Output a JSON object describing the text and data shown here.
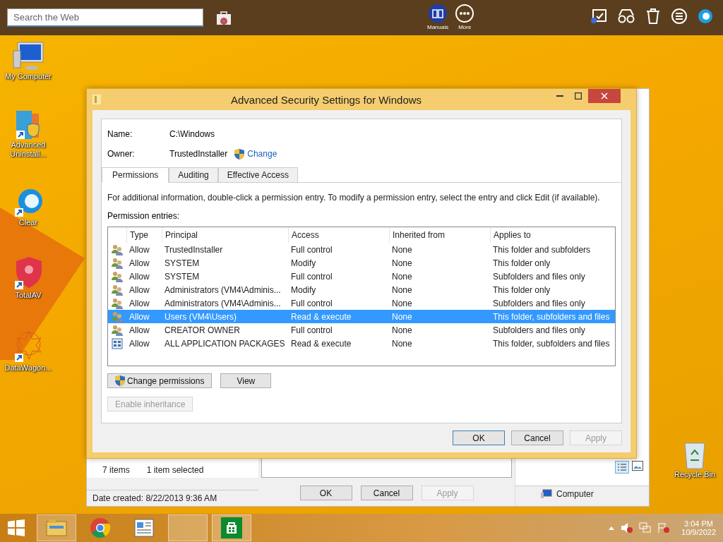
{
  "top_bar": {
    "search_placeholder": "Search the Web",
    "apps": [
      {
        "kind": "manuals",
        "label": "Manuals"
      },
      {
        "kind": "more",
        "label": "More"
      }
    ]
  },
  "desktop_icons": [
    {
      "kind": "computer",
      "label": "My Computer"
    },
    {
      "kind": "uninstaller",
      "label": "Advanced Uninstall..."
    },
    {
      "kind": "clear",
      "label": "Clear"
    },
    {
      "kind": "shield",
      "label": "TotalAV"
    },
    {
      "kind": "star",
      "label": "DataWagon..."
    }
  ],
  "recycle_bin": {
    "label": "Recycle Bin"
  },
  "back_window": {
    "item_count": "7 items",
    "selection": "1 item selected",
    "date_created": "Date created: 8/22/2013 9:36 AM",
    "location": "Computer",
    "buttons": [
      {
        "label": "OK",
        "disabled": false
      },
      {
        "label": "Cancel",
        "disabled": false
      },
      {
        "label": "Apply",
        "disabled": true
      }
    ]
  },
  "dialog": {
    "title": "Advanced Security Settings for Windows",
    "name_label": "Name:",
    "name_value": "C:\\Windows",
    "owner_label": "Owner:",
    "owner_value": "TrustedInstaller",
    "change_link": "Change",
    "tabs": [
      {
        "label": "Permissions",
        "selected": true
      },
      {
        "label": "Auditing",
        "selected": false
      },
      {
        "label": "Effective Access",
        "selected": false
      }
    ],
    "info": "For additional information, double-click a permission entry. To modify a permission entry, select the entry and click Edit (if available).",
    "entries_label": "Permission entries:",
    "columns": [
      "Type",
      "Principal",
      "Access",
      "Inherited from",
      "Applies to"
    ],
    "rows": [
      {
        "kind": "user",
        "type": "Allow",
        "principal": "TrustedInstaller",
        "access": "Full control",
        "inherited": "None",
        "applies": "This folder and subfolders",
        "selected": false
      },
      {
        "kind": "user",
        "type": "Allow",
        "principal": "SYSTEM",
        "access": "Modify",
        "inherited": "None",
        "applies": "This folder only",
        "selected": false
      },
      {
        "kind": "user",
        "type": "Allow",
        "principal": "SYSTEM",
        "access": "Full control",
        "inherited": "None",
        "applies": "Subfolders and files only",
        "selected": false
      },
      {
        "kind": "user",
        "type": "Allow",
        "principal": "Administrators (VM4\\Adminis...",
        "access": "Modify",
        "inherited": "None",
        "applies": "This folder only",
        "selected": false
      },
      {
        "kind": "user",
        "type": "Allow",
        "principal": "Administrators (VM4\\Adminis...",
        "access": "Full control",
        "inherited": "None",
        "applies": "Subfolders and files only",
        "selected": false
      },
      {
        "kind": "user",
        "type": "Allow",
        "principal": "Users (VM4\\Users)",
        "access": "Read & execute",
        "inherited": "None",
        "applies": "This folder, subfolders and files",
        "selected": true
      },
      {
        "kind": "user",
        "type": "Allow",
        "principal": "CREATOR OWNER",
        "access": "Full control",
        "inherited": "None",
        "applies": "Subfolders and files only",
        "selected": false
      },
      {
        "kind": "package",
        "type": "Allow",
        "principal": "ALL APPLICATION PACKAGES",
        "access": "Read & execute",
        "inherited": "None",
        "applies": "This folder, subfolders and files",
        "selected": false
      }
    ],
    "actions": [
      {
        "label": "Change permissions",
        "shield": true,
        "disabled": false
      },
      {
        "label": "View",
        "shield": false,
        "disabled": false
      }
    ],
    "inheritance_button": {
      "label": "Enable inheritance",
      "disabled": true
    },
    "buttons": [
      {
        "label": "OK",
        "default": true,
        "disabled": false
      },
      {
        "label": "Cancel",
        "default": false,
        "disabled": false
      },
      {
        "label": "Apply",
        "default": false,
        "disabled": true
      }
    ]
  },
  "taskbar": {
    "apps": [
      {
        "kind": "explorer",
        "active": true
      },
      {
        "kind": "chrome",
        "active": false
      },
      {
        "kind": "document",
        "active": false
      },
      {
        "kind": "blank",
        "active": true
      },
      {
        "kind": "store",
        "active": true
      }
    ],
    "time": "3:04 PM",
    "date": "10/9/2022"
  }
}
